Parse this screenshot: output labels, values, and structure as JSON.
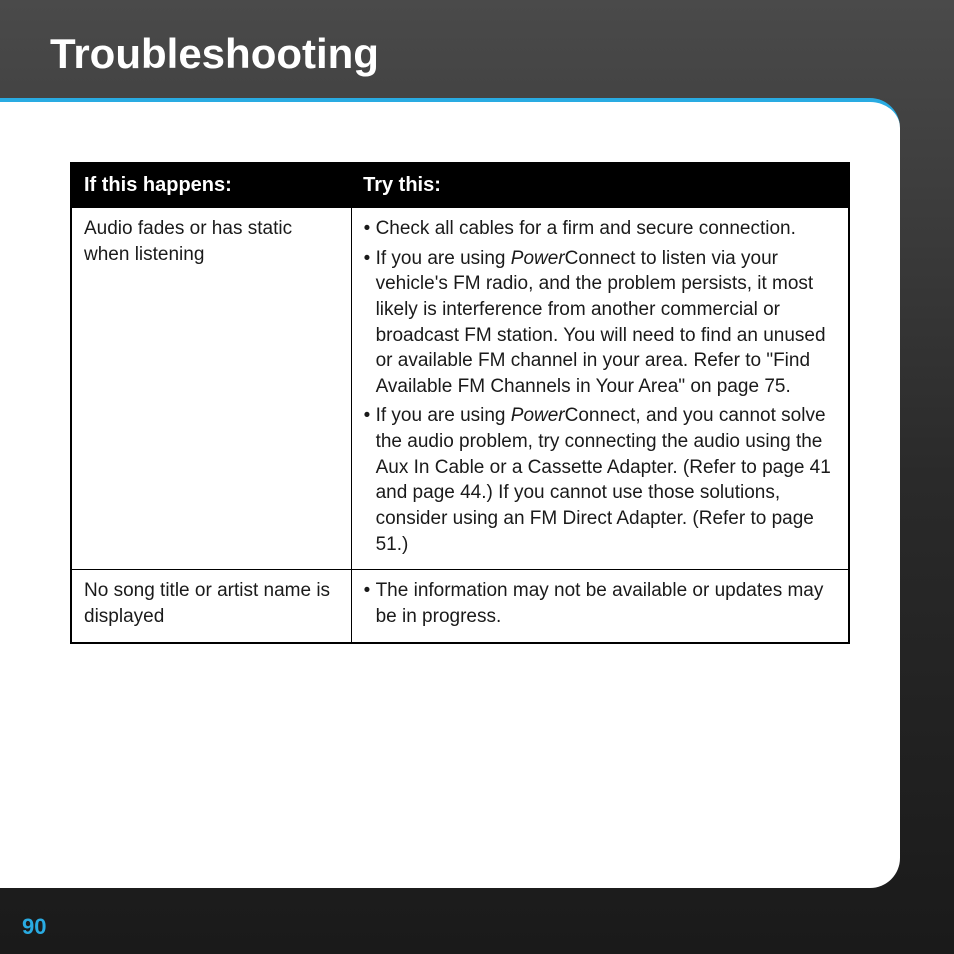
{
  "title": "Troubleshooting",
  "table": {
    "header": {
      "col1": "If this happens:",
      "col2": "Try this:"
    },
    "rows": [
      {
        "problem": "Audio fades or has static when listening",
        "solutions": [
          {
            "pre": "Check all cables for a firm and secure connection.",
            "italic": "",
            "post": ""
          },
          {
            "pre": "If you are using ",
            "italic": "Power",
            "post": "Connect to listen via your vehicle's FM radio, and the problem persists, it most likely is interference from another commercial or broadcast FM station. You will need to find an unused or available FM channel in your area. Refer to \"Find Available FM Channels in Your Area\" on page 75."
          },
          {
            "pre": "If you are using ",
            "italic": "Power",
            "post": "Connect, and you cannot solve the audio problem, try connecting the audio using the Aux In Cable or a Cassette Adapter. (Refer to page 41 and page 44.) If you cannot use those solutions, consider using an FM Direct Adapter. (Refer to page 51.)"
          }
        ]
      },
      {
        "problem": "No song title or artist name is displayed",
        "solutions": [
          {
            "pre": "The information may not be available or updates may be in progress.",
            "italic": "",
            "post": ""
          }
        ]
      }
    ]
  },
  "page_number": "90"
}
